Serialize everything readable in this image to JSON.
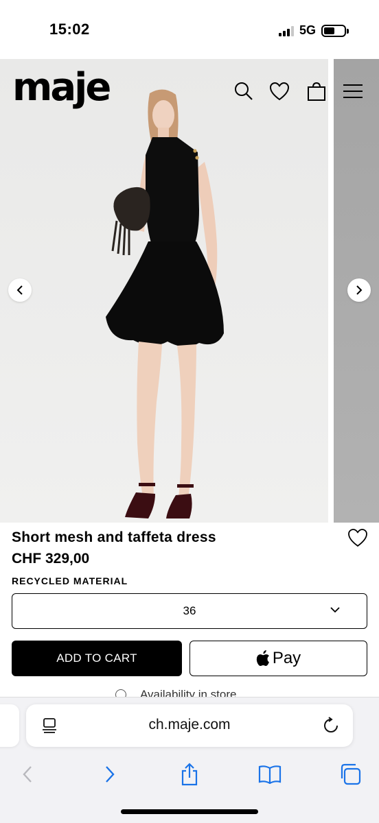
{
  "status_bar": {
    "time": "15:02",
    "network": "5G"
  },
  "header": {
    "logo": "maje",
    "icons": [
      "search-icon",
      "heart-icon",
      "bag-icon",
      "menu-icon"
    ]
  },
  "product": {
    "title": "Short mesh and taffeta dress",
    "price": "CHF 329,00",
    "tag": "RECYCLED MATERIAL",
    "size": {
      "selected": "36"
    },
    "add_to_cart_label": "ADD TO CART",
    "apple_pay_label": "Pay",
    "availability_label": "Availability in store"
  },
  "browser": {
    "url": "ch.maje.com"
  },
  "colors": {
    "accent": "#000000",
    "safari_blue": "#1a73e8",
    "background": "#ffffff"
  }
}
